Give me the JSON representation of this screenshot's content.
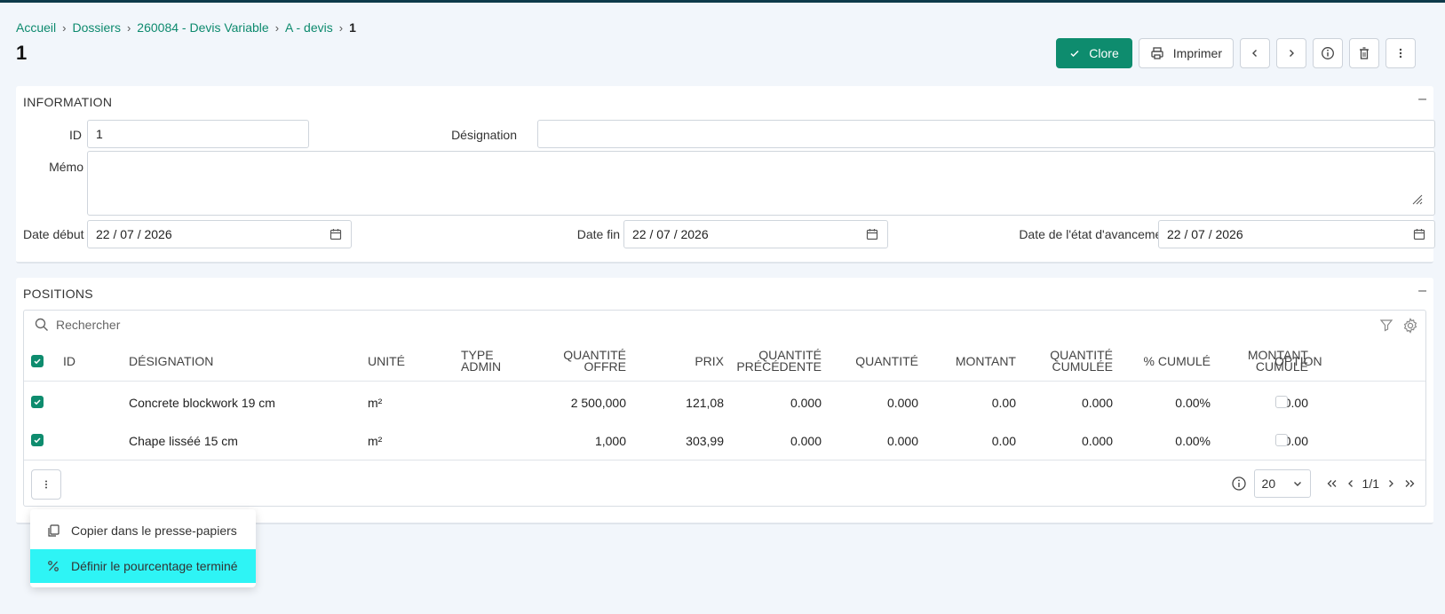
{
  "breadcrumb": [
    "Accueil",
    "Dossiers",
    "260084 - Devis Variable",
    "A - devis",
    "1"
  ],
  "page_title": "1",
  "toolbar": {
    "close_label": "Clore",
    "print_label": "Imprimer"
  },
  "information": {
    "title": "INFORMATION",
    "collapse": "–",
    "id_label": "ID",
    "id_value": "1",
    "designation_label": "Désignation",
    "designation_value": "",
    "memo_label": "Mémo",
    "date_debut_label": "Date début",
    "date_debut_value": "22 / 07 / 2026",
    "date_fin_label": "Date fin",
    "date_fin_value": "22 / 07 / 2026",
    "date_etat_label": "Date de l'état d'avancement",
    "date_etat_value": "22 / 07 / 2026"
  },
  "positions": {
    "title": "POSITIONS",
    "collapse": "–",
    "search_placeholder": "Rechercher",
    "columns": {
      "id": "ID",
      "designation": "DÉSIGNATION",
      "unite": "UNITÉ",
      "type_admin_1": "TYPE",
      "type_admin_2": "ADMIN",
      "qte_offre_1": "QUANTITÉ",
      "qte_offre_2": "OFFRE",
      "prix": "PRIX",
      "qte_prec_1": "QUANTITÉ",
      "qte_prec_2": "PRÉCÉDENTE",
      "quantite": "QUANTITÉ",
      "montant": "MONTANT",
      "qte_cum_1": "QUANTITÉ",
      "qte_cum_2": "CUMULÉE",
      "pct_cumule": "% CUMULÉ",
      "mont_cum_1": "MONTANT",
      "mont_cum_2": "CUMULÉ",
      "option": "OPTION"
    },
    "rows": [
      {
        "designation": "Concrete blockwork 19 cm",
        "unite": "m²",
        "qte_offre": "2 500,000",
        "prix": "121,08",
        "qte_prec": "0.000",
        "quantite": "0.000",
        "montant": "0.00",
        "qte_cum": "0.000",
        "pct": "0.00%",
        "mont_cum": "0.00"
      },
      {
        "designation": "Chape lisséé 15 cm",
        "unite": "m²",
        "qte_offre": "1,000",
        "prix": "303,99",
        "qte_prec": "0.000",
        "quantite": "0.000",
        "montant": "0.00",
        "qte_cum": "0.000",
        "pct": "0.00%",
        "mont_cum": "0.00"
      }
    ],
    "pager": {
      "page_size": "20",
      "page_info": "1/1"
    }
  },
  "context_menu": {
    "copy_label": "Copier dans le presse-papiers",
    "set_pct_label": "Définir le pourcentage terminé"
  },
  "colors": {
    "accent": "#0e8c6e",
    "highlight": "#2ef4f5",
    "link": "#0d8a6e"
  }
}
